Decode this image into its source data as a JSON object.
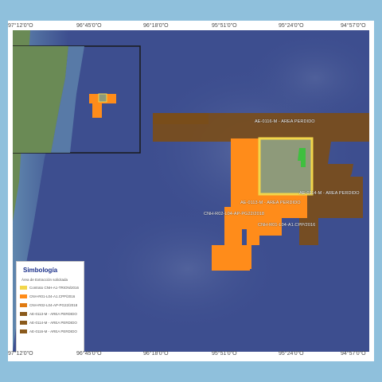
{
  "coords": {
    "top": [
      "97°12'0\"O",
      "96°45'0\"O",
      "96°18'0\"O",
      "95°51'0\"O",
      "95°24'0\"O",
      "94°57'0\"O"
    ],
    "bottom": [
      "97°12'0\"O",
      "96°45'0\"O",
      "96°18'0\"O",
      "95°51'0\"O",
      "95°24'0\"O",
      "94°57'0\"O"
    ]
  },
  "blocks": {
    "ae0116": "AE-0116-M - AREA PERDIDO",
    "ae0114": "AE-0114-M - AREA PERDIDO",
    "ae0113": "AE-0113-M - AREA PERDIDO",
    "cnh_r02": "CNH-R02-L04-AP-PG22/2018",
    "cnh_r01": "CNH-R01-L04-A1.CPP/2016"
  },
  "legend": {
    "title": "Simbología",
    "heading": "Área de Extracción solicitada",
    "items": [
      {
        "label": "Contrato CNH-A1-TRION/2016",
        "color": "#f2d64a"
      },
      {
        "label": "CNH-R01-L04-A1.CPP/2016",
        "color": "#ff8c1a"
      },
      {
        "label": "CNH-R02-L04-AP-PG22/2018",
        "color": "#e07a10"
      },
      {
        "label": "AE-0113-M - AREA PERDIDO",
        "color": "#8a5a1c"
      },
      {
        "label": "AE-0114-M - AREA PERDIDO",
        "color": "#8a5a1c"
      },
      {
        "label": "AE-0116-M - AREA PERDIDO",
        "color": "#8a5a1c"
      }
    ]
  },
  "colors": {
    "orange": "#ff8c1a",
    "brown": "#7a4d1a",
    "yellow": "#f2d64a",
    "green": "#3fbf3f",
    "ocean": "#3d4e8f",
    "land": "#6a8a55"
  }
}
